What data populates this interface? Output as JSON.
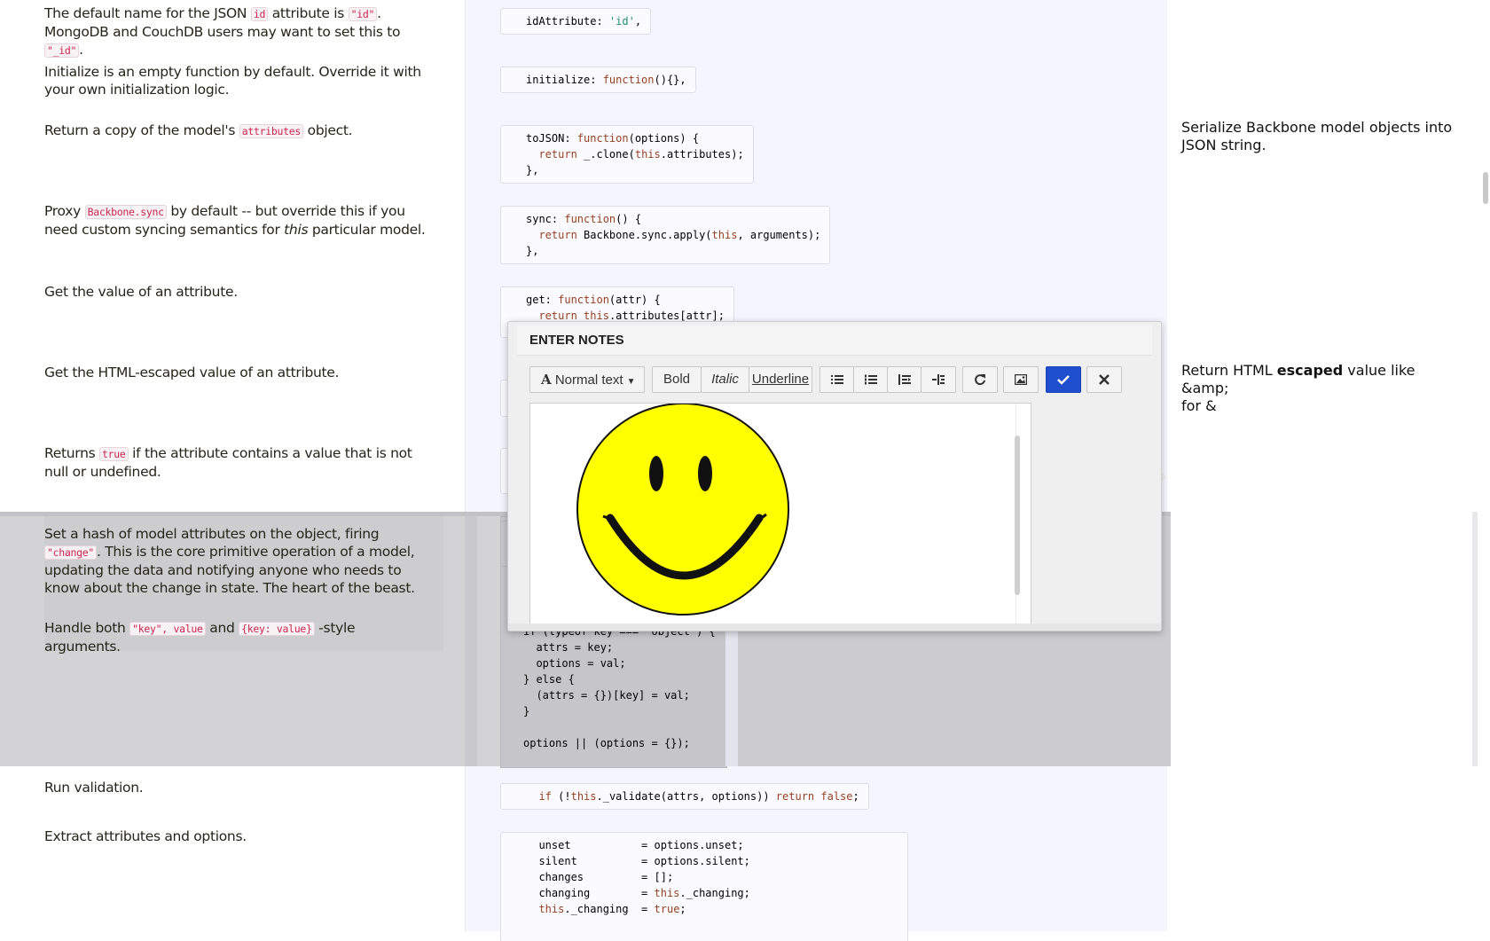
{
  "docs": {
    "id_attr": {
      "pre": "The default name for the JSON ",
      "code1": "id",
      "mid": " attribute is ",
      "code2": "\"id\"",
      "mid2": ". MongoDB and CouchDB users may want to set this to ",
      "code3": "\"_id\"",
      "post": "."
    },
    "initialize": "Initialize is an empty function by default. Override it with your own initialization logic.",
    "tojson": {
      "pre": "Return a copy of the model's ",
      "code": "attributes",
      "post": " object."
    },
    "sync": {
      "pre": "Proxy ",
      "code": "Backbone.sync",
      "mid": " by default -- but override this if you need custom syncing semantics for ",
      "em": "this",
      "post": " particular model."
    },
    "get": "Get the value of an attribute.",
    "escape": "Get the HTML-escaped value of an attribute.",
    "has": {
      "pre": "Returns ",
      "code": "true",
      "post": " if the attribute contains a value that is not null or undefined."
    },
    "set1": {
      "pre": "Set a hash of model attributes on the object, firing ",
      "code": "\"change\"",
      "post": ". This is the core primitive operation of a model, updating the data and notifying anyone who needs to know about the change in state. The heart of the beast."
    },
    "set2": {
      "pre": "Handle both ",
      "code1": "\"key\", value",
      "mid": " and ",
      "code2": "{key: value}",
      "post": " -style arguments."
    },
    "validation": "Run validation.",
    "extract": "Extract attributes and options."
  },
  "code": {
    "idattr": {
      "a": "idAttribute: ",
      "s": "'id'",
      "b": ","
    },
    "init": {
      "a": "initialize: ",
      "k": "function",
      "b": "(){},"
    },
    "tojson": {
      "l1a": "toJSON: ",
      "l1k": "function",
      "l1b": "(options) {",
      "l2k": "return",
      "l2b": " _.clone(",
      "l2k2": "this",
      "l2c": ".attributes);",
      "l3": "},"
    },
    "sync": {
      "l1a": "sync: ",
      "l1k": "function",
      "l1b": "() {",
      "l2k": "return",
      "l2b": " Backbone.sync.apply(",
      "l2k2": "this",
      "l2c": ", arguments);",
      "l3": "},"
    },
    "get": {
      "l1a": "get: ",
      "l1k": "function",
      "l1b": "(attr) {",
      "l2k": "return",
      "l2k2": " this",
      "l2c": ".attributes[attr];"
    },
    "set": {
      "l0": "if (typeof key === 'object') {",
      "l1": "  attrs = key;",
      "l2": "  options = val;",
      "l3": "} else {",
      "l4": "  (attrs = {})[key] = val;",
      "l5": "}",
      "l6": "options || (options = {});"
    },
    "validate": {
      "a": "if",
      "b": " (!",
      "c": "this",
      "d": "._validate(attrs, options)) ",
      "e": "return",
      "f": " false",
      "g": ";"
    },
    "extract": {
      "l1": "unset           = options.unset;",
      "l2": "silent          = options.silent;",
      "l3": "changes         = [];",
      "l4a": "changing        = ",
      "l4k": "this",
      "l4b": "._changing;",
      "l5k": "this",
      "l5a": "._changing  = ",
      "l5t": "true",
      "l5b": ";"
    }
  },
  "side_notes": {
    "tojson": "Serialize Backbone model objects into JSON string.",
    "escape": {
      "pre": "Return HTML ",
      "bold": "escaped",
      "post": " value like",
      "line2": "&amp;",
      "line3": "for &"
    }
  },
  "modal": {
    "title": "ENTER NOTES",
    "format_dropdown": "Normal text",
    "bold": "Bold",
    "italic": "Italic",
    "underline": "Underline",
    "icons": [
      "list-unordered-icon",
      "list-ordered-icon",
      "outdent-icon",
      "indent-icon",
      "redo-icon",
      "image-icon",
      "check-icon",
      "close-icon"
    ],
    "colors": {
      "primary": "#1f4fcf",
      "smiley_face": "#ffff00",
      "smiley_outline": "#111111"
    }
  }
}
